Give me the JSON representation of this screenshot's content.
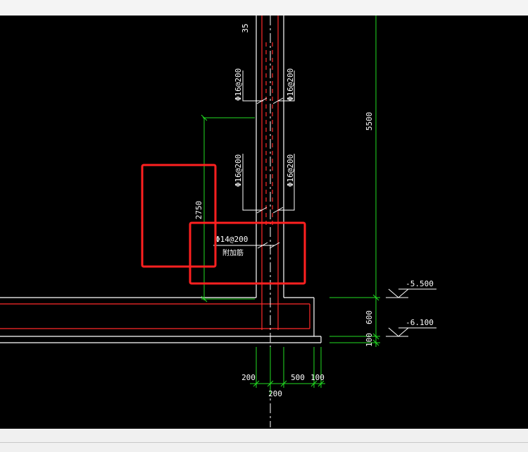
{
  "drawing": {
    "top_cut_label": "35",
    "rebar_labels": {
      "upper_left": "Φ16@200",
      "upper_right": "Φ16@200",
      "lower_left": "Φ16@200",
      "lower_right": "Φ16@200",
      "horizontal": "Φ14@200",
      "horizontal_note": "附加筋"
    },
    "dimensions": {
      "overall_height": "5500",
      "lower_height": "2750",
      "footing_thickness": "600",
      "blinding": "100",
      "bottom_left": "200",
      "bottom_mid": "500",
      "bottom_right": "100",
      "bottom_center": "200"
    },
    "levels": {
      "upper": "-5.500",
      "lower": "-6.100"
    },
    "highlight_color": "#ff2020",
    "background_color": "#000000"
  }
}
